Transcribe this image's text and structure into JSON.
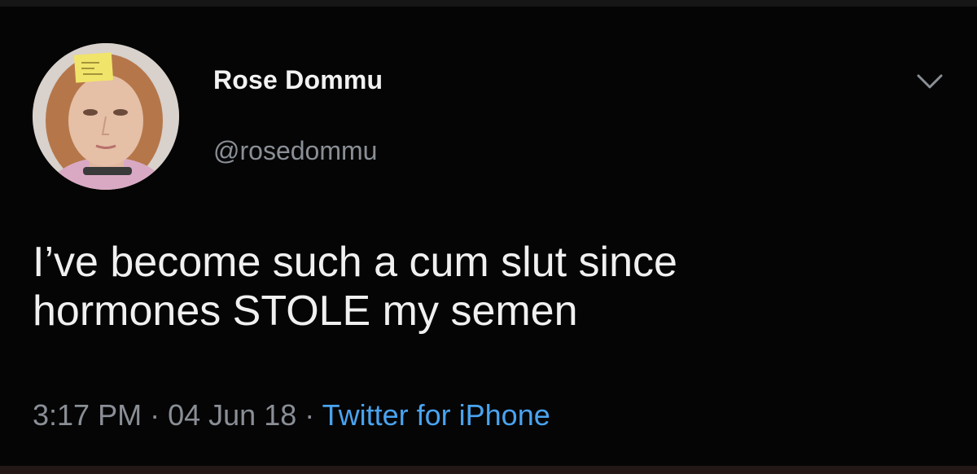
{
  "tweet": {
    "display_name": "Rose Dommu",
    "handle": "@rosedommu",
    "text_line_1": "I’ve become such a cum slut since",
    "text_line_2": "hormones STOLE my semen",
    "time": "3:17 PM",
    "separator": "·",
    "date": "04 Jun 18",
    "source": "Twitter for iPhone"
  },
  "icons": {
    "avatar": "profile-photo",
    "menu": "chevron-down-icon"
  },
  "colors": {
    "background": "#050505",
    "text_primary": "#f0f0f0",
    "text_secondary": "#8a8f96",
    "link": "#4aa3ef"
  }
}
